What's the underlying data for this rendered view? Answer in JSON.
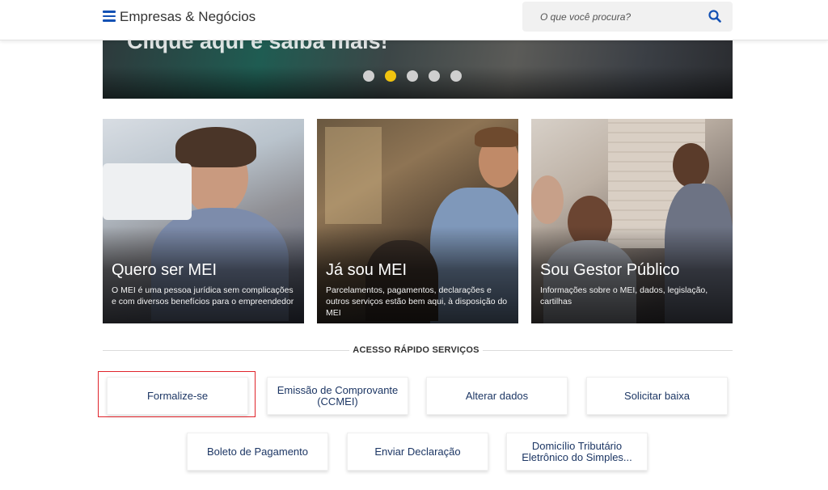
{
  "header": {
    "brand": "Empresas & Negócios",
    "search_placeholder": "O que você procura?",
    "menu_icon": "hamburger-menu-icon",
    "search_icon": "search-icon",
    "accent_color": "#1351b4"
  },
  "banner": {
    "text": "Clique aqui e saiba mais!",
    "slides_total": 5,
    "active_slide": 2,
    "active_dot_color": "#f0c30f"
  },
  "cards": [
    {
      "title": "Quero ser MEI",
      "description": "O MEI é uma pessoa jurídica sem complicações e com diversos benefícios para o empreendedor"
    },
    {
      "title": "Já sou MEI",
      "description": "Parcelamentos, pagamentos, declarações e outros serviços estão bem aqui, à disposição do MEI"
    },
    {
      "title": "Sou Gestor Público",
      "description": "Informações sobre o MEI, dados, legislação, cartilhas"
    }
  ],
  "quick_access": {
    "title": "ACESSO RÁPIDO SERVIÇOS",
    "buttons": [
      "Formalize-se",
      "Emissão de Comprovante (CCMEI)",
      "Alterar dados",
      "Solicitar baixa",
      "Boleto de Pagamento",
      "Enviar Declaração",
      "Domicílio Tributário Eletrônico do Simples..."
    ],
    "highlight_color": "#e0242b",
    "text_color": "#1c3664"
  }
}
